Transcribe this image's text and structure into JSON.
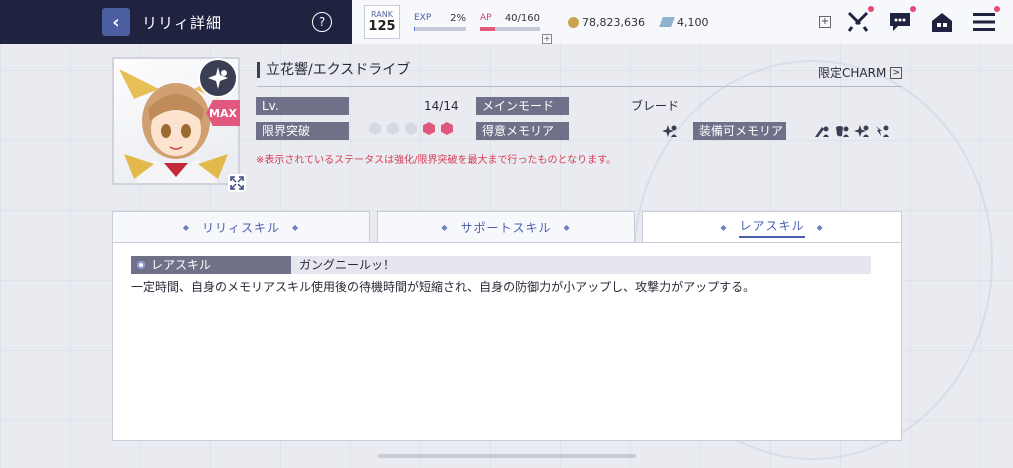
{
  "header": {
    "title": "リリィ詳細",
    "back_icon": "chevron-left-icon",
    "help_label": "?"
  },
  "status": {
    "rank_label": "RANK",
    "rank_value": "125",
    "exp_label": "EXP",
    "exp_value": "2%",
    "exp_fraction": 0.02,
    "ap_label": "AP",
    "ap_value": "40/160",
    "ap_fraction": 0.25,
    "gold": "78,823,636",
    "crystal": "4,100",
    "plus_label": "+"
  },
  "colors": {
    "header_bg": "#1f2340",
    "accent": "#4a5fb0",
    "ap": "#e25a7a",
    "notification": "#e84a78",
    "stat_label_bg": "#6e7188",
    "notice": "#d73b55"
  },
  "character": {
    "name": "立花響/エクスドライブ",
    "max_badge": "MAX",
    "charm_link": "限定CHARM",
    "charm_arrow": ">",
    "lv_label": "Lv.",
    "lv_value": "14/14",
    "limit_break_label": "限界突破",
    "limit_break_filled": 2,
    "limit_break_total": 5,
    "main_mode_label": "メインモード",
    "main_mode_value": "ブレード",
    "favorite_memoria_label": "得意メモリア",
    "equippable_memoria_label": "装備可メモリア",
    "notice": "※表示されているステータスは強化/限界突破を最大まで行ったものとなります。"
  },
  "tabs": [
    {
      "label": "リリィスキル",
      "active": false
    },
    {
      "label": "サポートスキル",
      "active": false
    },
    {
      "label": "レアスキル",
      "active": true
    }
  ],
  "skill": {
    "type_label": "レアスキル",
    "name": "ガングニールッ！",
    "description": "一定時間、自身のメモリアスキル使用後の待機時間が短縮され、自身の防御力が小アップし、攻撃力がアップする。"
  }
}
